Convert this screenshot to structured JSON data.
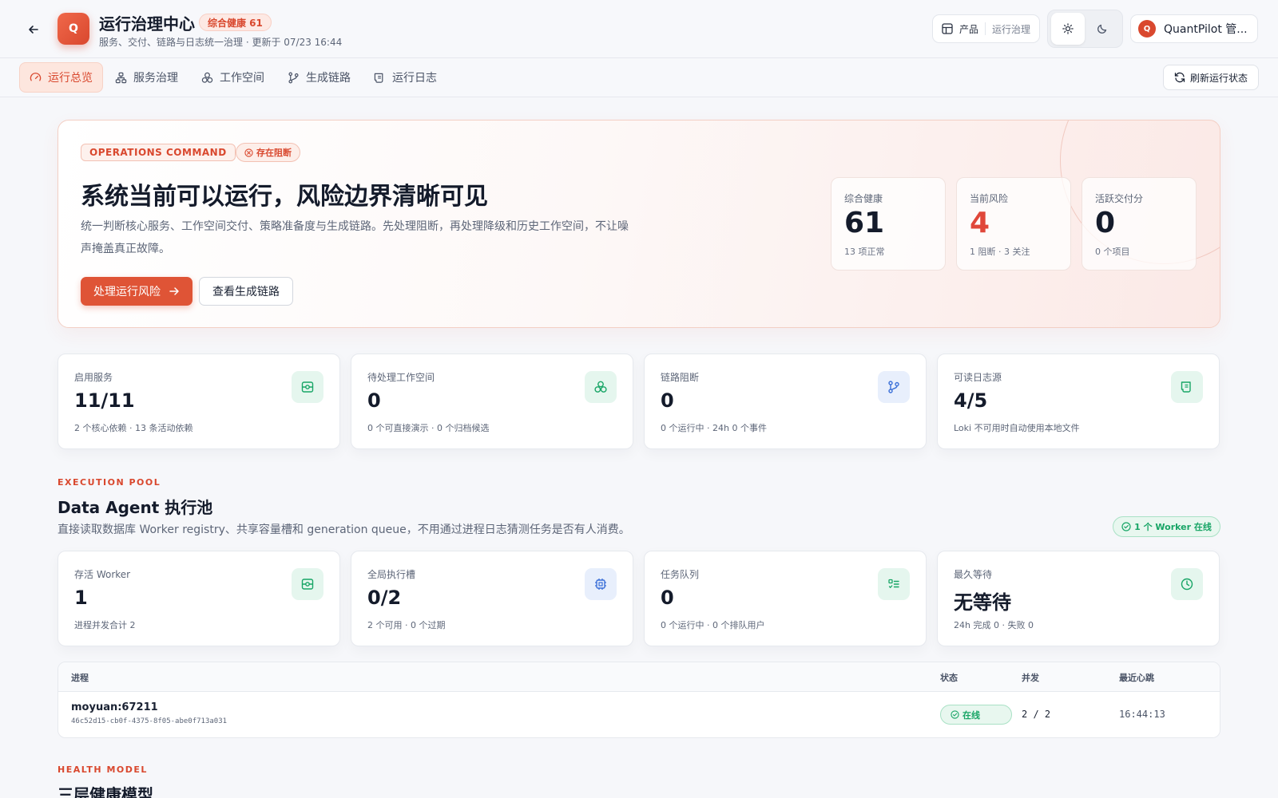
{
  "header": {
    "logo_letter": "Q",
    "title": "运行治理中心",
    "health_badge": "综合健康 61",
    "subtitle": "服务、交付、链路与日志统一治理 · 更新于 07/23 16:44",
    "context_main": "产品",
    "context_sub": "运行治理",
    "user_initial": "Q",
    "user_name": "QuantPilot 管..."
  },
  "nav": {
    "tabs": [
      {
        "label": "运行总览",
        "icon": "gauge-icon"
      },
      {
        "label": "服务治理",
        "icon": "network-icon"
      },
      {
        "label": "工作空间",
        "icon": "cubes-icon"
      },
      {
        "label": "生成链路",
        "icon": "git-branch-icon"
      },
      {
        "label": "运行日志",
        "icon": "scroll-icon"
      }
    ],
    "refresh_label": "刷新运行状态"
  },
  "hero": {
    "tag": "OPERATIONS COMMAND",
    "status": "存在阻断",
    "title": "系统当前可以运行，风险边界清晰可见",
    "desc": "统一判断核心服务、工作空间交付、策略准备度与生成链路。先处理阻断，再处理降级和历史工作空间，不让噪声掩盖真正故障。",
    "primary_btn": "处理运行风险",
    "secondary_btn": "查看生成链路",
    "metrics": [
      {
        "label": "综合健康",
        "value": "61",
        "sub": "13 项正常"
      },
      {
        "label": "当前风险",
        "value": "4",
        "sub": "1 阻断 · 3 关注"
      },
      {
        "label": "活跃交付分",
        "value": "0",
        "sub": "0 个项目"
      }
    ]
  },
  "stats": [
    {
      "label": "启用服务",
      "value": "11/11",
      "sub": "2 个核心依赖 · 13 条活动依赖",
      "icon": "server-icon"
    },
    {
      "label": "待处理工作空间",
      "value": "0",
      "sub": "0 个可直接演示 · 0 个归档候选",
      "icon": "cubes-icon"
    },
    {
      "label": "链路阻断",
      "value": "0",
      "sub": "0 个运行中 · 24h 0 个事件",
      "icon": "git-branch-icon"
    },
    {
      "label": "可读日志源",
      "value": "4/5",
      "sub": "Loki 不可用时自动使用本地文件",
      "icon": "scroll-icon"
    }
  ],
  "pool": {
    "eyebrow": "EXECUTION POOL",
    "title": "Data Agent 执行池",
    "desc": "直接读取数据库 Worker registry、共享容量槽和 generation queue，不用通过进程日志猜测任务是否有人消费。",
    "online": "1 个 Worker 在线",
    "stats": [
      {
        "label": "存活 Worker",
        "value": "1",
        "sub": "进程并发合计 2",
        "icon": "server-icon"
      },
      {
        "label": "全局执行槽",
        "value": "0/2",
        "sub": "2 个可用 · 0 个过期",
        "icon": "cpu-icon"
      },
      {
        "label": "任务队列",
        "value": "0",
        "sub": "0 个运行中 · 0 个排队用户",
        "icon": "list-check-icon"
      },
      {
        "label": "最久等待",
        "value": "无等待",
        "sub": "24h 完成 0 · 失败 0",
        "icon": "clock-icon"
      }
    ],
    "table": {
      "headers": [
        "进程",
        "状态",
        "并发",
        "最近心跳"
      ],
      "rows": [
        {
          "process": "moyuan:67211",
          "id": "46c52d15-cb0f-4375-8f05-abe0f713a031",
          "status": "在线",
          "concurrency": "2 / 2",
          "heartbeat": "16:44:13"
        }
      ]
    }
  },
  "health_model": {
    "eyebrow": "HEALTH MODEL",
    "title": "三层健康模型"
  },
  "colors": {
    "accent": "#d9482e",
    "success": "#18a566",
    "info": "#3a6fd8"
  }
}
